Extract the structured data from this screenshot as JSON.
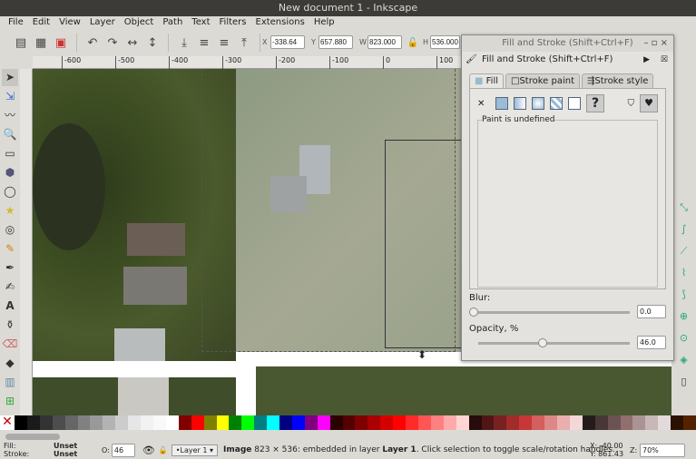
{
  "window": {
    "title": "New document 1 - Inkscape"
  },
  "menu": [
    "File",
    "Edit",
    "View",
    "Layer",
    "Object",
    "Path",
    "Text",
    "Filters",
    "Extensions",
    "Help"
  ],
  "toolbar": {
    "x_label": "X",
    "x": "-338.64",
    "y_label": "Y",
    "y": "657.880",
    "w_label": "W",
    "w": "823.000",
    "h_label": "H",
    "h": "536.000"
  },
  "ruler": [
    "-600",
    "-500",
    "-400",
    "-300",
    "-200",
    "-100",
    "0",
    "100"
  ],
  "dialog": {
    "window_title": "Fill and Stroke (Shift+Ctrl+F)",
    "header": "Fill and Stroke (Shift+Ctrl+F)",
    "tabs": [
      "Fill",
      "Stroke paint",
      "Stroke style"
    ],
    "paint_status": "Paint is undefined",
    "unknown_label": "?",
    "blur_label": "Blur:",
    "blur": "0.0",
    "blur_pct": 0,
    "opacity_label": "Opacity, %",
    "opacity": "46.0",
    "opacity_pct": 46
  },
  "palette": [
    "#000000",
    "#1a1a1a",
    "#333333",
    "#4d4d4d",
    "#666666",
    "#808080",
    "#999999",
    "#b3b3b3",
    "#cccccc",
    "#e6e6e6",
    "#f2f2f2",
    "#f9f9f9",
    "#ffffff",
    "#800000",
    "#ff0000",
    "#808000",
    "#ffff00",
    "#008000",
    "#00ff00",
    "#008080",
    "#00ffff",
    "#000080",
    "#0000ff",
    "#800080",
    "#ff00ff",
    "#2b0000",
    "#550000",
    "#800000",
    "#aa0000",
    "#d40000",
    "#ff0000",
    "#ff2a2a",
    "#ff5555",
    "#ff8080",
    "#ffaaaa",
    "#ffd5d5",
    "#280b0b",
    "#501616",
    "#782121",
    "#a02c2c",
    "#c83737",
    "#d35f5f",
    "#de8787",
    "#e9afaf",
    "#f4d7d7",
    "#241c1c",
    "#483737",
    "#6c5353",
    "#916f6f",
    "#ac9393",
    "#c8b7b7",
    "#e3dbdb",
    "#2b1100",
    "#552200"
  ],
  "status": {
    "fill_label": "Fill:",
    "fill": "Unset",
    "stroke_label": "Stroke:",
    "stroke": "Unset",
    "opacity_label": "O:",
    "opacity": "46",
    "layer": "•Layer 1",
    "msg_bold": "Image",
    "msg": " 823 × 536: embedded in layer ",
    "msg_layer": "Layer 1",
    "msg_tail": ". Click selection to toggle scale/rotation handles.",
    "cx": "X: -40.00",
    "cy": "Y: 861.43",
    "zoom_label": "Z:",
    "zoom": "70%"
  }
}
